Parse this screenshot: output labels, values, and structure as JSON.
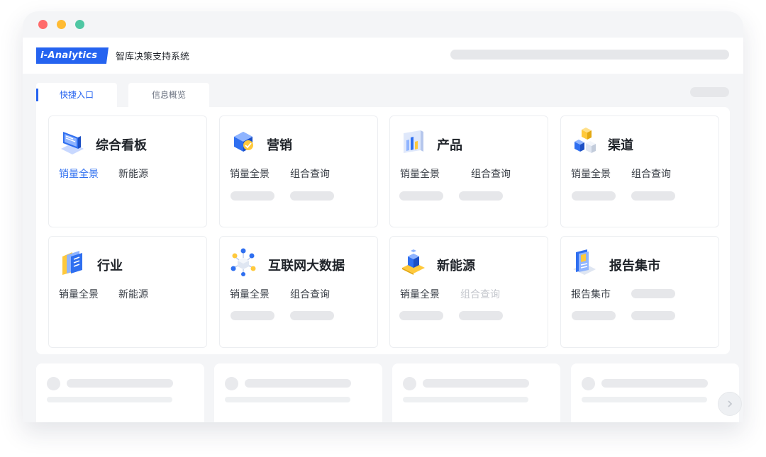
{
  "window": {
    "dots": [
      {
        "name": "close",
        "color": "#ff6b6b"
      },
      {
        "name": "minimize",
        "color": "#ffbb33"
      },
      {
        "name": "maximize",
        "color": "#4fc7a3"
      }
    ]
  },
  "header": {
    "logo_text": "i-Analytics",
    "app_name": "智库决策支持系统"
  },
  "tabs": [
    {
      "label": "快捷入口",
      "active": true
    },
    {
      "label": "信息概览",
      "active": false
    }
  ],
  "cards": [
    {
      "title": "综合看板",
      "icon": "monitor-icon",
      "links": [
        "销量全景",
        "新能源"
      ]
    },
    {
      "title": "营销",
      "icon": "marketing-cube-icon",
      "links": [
        "销量全景",
        "组合查询"
      ]
    },
    {
      "title": "产品",
      "icon": "product-chart-icon",
      "links": [
        "销量全景",
        "组合查询"
      ]
    },
    {
      "title": "渠道",
      "icon": "channel-blocks-icon",
      "links": [
        "销量全景",
        "组合查询"
      ]
    },
    {
      "title": "行业",
      "icon": "industry-folder-icon",
      "links": [
        "销量全景",
        "新能源"
      ]
    },
    {
      "title": "互联网大数据",
      "icon": "network-nodes-icon",
      "links": [
        "销量全景",
        "组合查询"
      ]
    },
    {
      "title": "新能源",
      "icon": "new-energy-icon",
      "links": [
        "销量全景",
        "组合查询"
      ]
    },
    {
      "title": "报告集市",
      "icon": "report-icon",
      "links": [
        "报告集市"
      ]
    }
  ],
  "colors": {
    "accent": "#2563f0",
    "link_active": "#2f6ff0",
    "link_disabled": "#c4c7cd",
    "placeholder": "#e6e7ea"
  }
}
